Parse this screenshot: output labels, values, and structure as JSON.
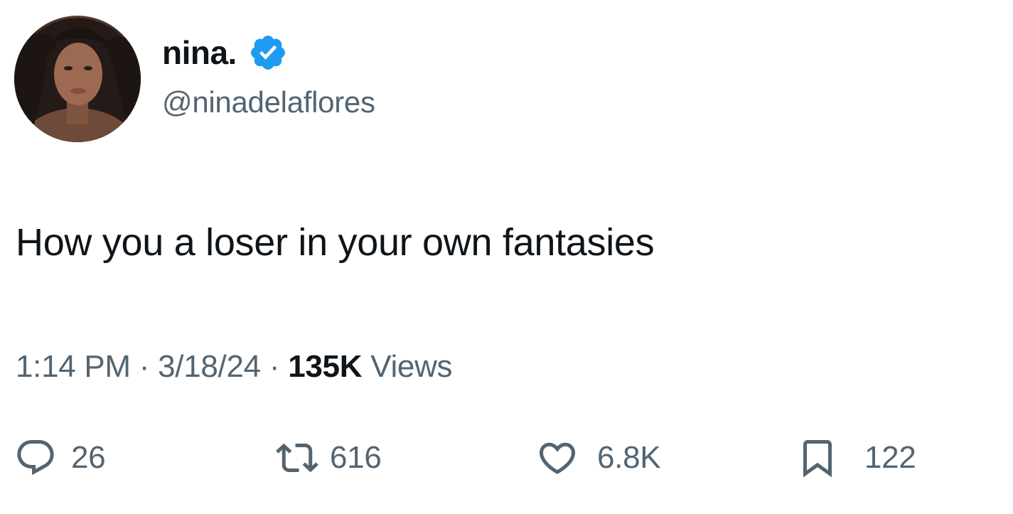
{
  "author": {
    "display_name": "nina.",
    "handle": "@ninadelaflores",
    "verified": true,
    "verified_badge_color": "#1d9bf0"
  },
  "tweet": {
    "text": "How you a loser in your own fantasies",
    "time": "1:14 PM",
    "date": "3/18/24",
    "separator": "·",
    "views_count": "135K",
    "views_label": "Views"
  },
  "actions": {
    "reply": {
      "icon": "reply-icon",
      "count": "26"
    },
    "retweet": {
      "icon": "retweet-icon",
      "count": "616"
    },
    "like": {
      "icon": "heart-icon",
      "count": "6.8K"
    },
    "bookmark": {
      "icon": "bookmark-icon",
      "count": "122"
    }
  },
  "colors": {
    "primary_text": "#0f1419",
    "secondary_text": "#536471",
    "background": "#ffffff"
  }
}
